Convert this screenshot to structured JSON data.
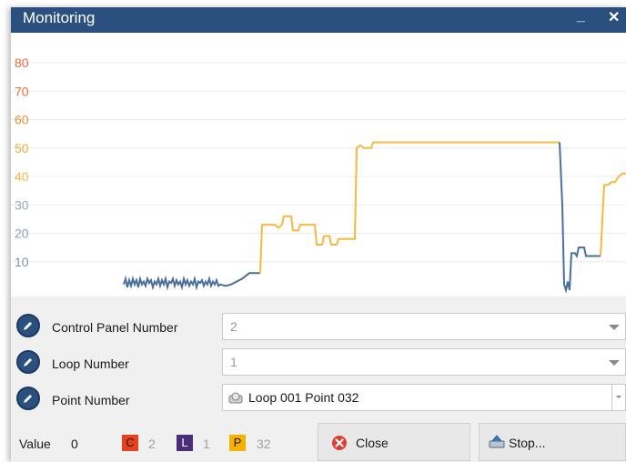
{
  "window": {
    "title": "Monitoring",
    "minimize_label": "_",
    "close_label": "✕"
  },
  "chart_data": {
    "type": "line",
    "y_ticks": [
      "80",
      "70",
      "60",
      "50",
      "40",
      "30",
      "20",
      "10"
    ],
    "ylim": [
      0,
      88
    ],
    "grid": true,
    "series": [
      {
        "color": "#4a6f9a",
        "points": [
          [
            124,
            2
          ],
          [
            126,
            4
          ],
          [
            128,
            1
          ],
          [
            130,
            3.5
          ],
          [
            132,
            1.5
          ],
          [
            134,
            4
          ],
          [
            136,
            2
          ],
          [
            138,
            3.5
          ],
          [
            140,
            1
          ],
          [
            142,
            4
          ],
          [
            144,
            2
          ],
          [
            146,
            3
          ],
          [
            148,
            1.5
          ],
          [
            150,
            4
          ],
          [
            152,
            2.5
          ],
          [
            154,
            3.5
          ],
          [
            156,
            1
          ],
          [
            158,
            3
          ],
          [
            160,
            2
          ],
          [
            162,
            4
          ],
          [
            164,
            1.5
          ],
          [
            166,
            3.5
          ],
          [
            168,
            2
          ],
          [
            170,
            4
          ],
          [
            172,
            1
          ],
          [
            174,
            3
          ],
          [
            176,
            2.5
          ],
          [
            178,
            4
          ],
          [
            180,
            1.5
          ],
          [
            182,
            3.5
          ],
          [
            184,
            2
          ],
          [
            186,
            3
          ],
          [
            188,
            1
          ],
          [
            190,
            4
          ],
          [
            192,
            2
          ],
          [
            194,
            3.5
          ],
          [
            196,
            1.5
          ],
          [
            198,
            3
          ],
          [
            200,
            2
          ],
          [
            202,
            4
          ],
          [
            204,
            1
          ],
          [
            206,
            3
          ],
          [
            208,
            2.5
          ],
          [
            210,
            3.5
          ],
          [
            212,
            1.5
          ],
          [
            214,
            3
          ],
          [
            216,
            2
          ],
          [
            218,
            4
          ],
          [
            220,
            1.5
          ],
          [
            222,
            3
          ],
          [
            224,
            2
          ],
          [
            226,
            3.5
          ],
          [
            228,
            1.5
          ],
          [
            230,
            2
          ],
          [
            236,
            1.5
          ],
          [
            242,
            2
          ],
          [
            248,
            3
          ],
          [
            254,
            4
          ],
          [
            258,
            5
          ],
          [
            262,
            6
          ],
          [
            268,
            6
          ],
          [
            274,
            6
          ]
        ]
      },
      {
        "color": "#f5b942",
        "points": [
          [
            274,
            6
          ],
          [
            276,
            23
          ],
          [
            290,
            23
          ],
          [
            294,
            22
          ],
          [
            298,
            23
          ],
          [
            300,
            26
          ],
          [
            308,
            26
          ],
          [
            310,
            21
          ],
          [
            316,
            21
          ],
          [
            318,
            23
          ],
          [
            334,
            23
          ],
          [
            336,
            16
          ],
          [
            342,
            16
          ],
          [
            344,
            19
          ],
          [
            350,
            19
          ],
          [
            352,
            16
          ],
          [
            358,
            16
          ],
          [
            360,
            18
          ],
          [
            378,
            18
          ],
          [
            380,
            50
          ],
          [
            384,
            51
          ],
          [
            388,
            50
          ],
          [
            396,
            50
          ],
          [
            398,
            52
          ],
          [
            420,
            52
          ],
          [
            440,
            52
          ],
          [
            480,
            52
          ],
          [
            520,
            52
          ],
          [
            560,
            52
          ],
          [
            590,
            52
          ],
          [
            603,
            52
          ]
        ]
      },
      {
        "color": "#4a6f9a",
        "points": [
          [
            603,
            52
          ],
          [
            606,
            30
          ],
          [
            608,
            2
          ],
          [
            610,
            0
          ],
          [
            612,
            3
          ],
          [
            614,
            0
          ],
          [
            616,
            13
          ],
          [
            620,
            13
          ],
          [
            622,
            12
          ],
          [
            624,
            15
          ],
          [
            630,
            15
          ],
          [
            632,
            12
          ],
          [
            644,
            12
          ],
          [
            648,
            12
          ]
        ]
      },
      {
        "color": "#f5b942",
        "points": [
          [
            648,
            12
          ],
          [
            652,
            37
          ],
          [
            656,
            37
          ],
          [
            660,
            38
          ],
          [
            664,
            38
          ],
          [
            668,
            40
          ],
          [
            672,
            41
          ],
          [
            676,
            41
          ]
        ]
      }
    ]
  },
  "controls": {
    "control_panel": {
      "label": "Control Panel Number",
      "value": "2"
    },
    "loop": {
      "label": "Loop Number",
      "value": "1"
    },
    "point": {
      "label": "Point Number",
      "value": "Loop  001 Point 032"
    }
  },
  "status": {
    "value_label": "Value",
    "value": "0",
    "c_label": "C",
    "c_value": "2",
    "l_label": "L",
    "l_value": "1",
    "p_label": "P",
    "p_value": "32",
    "colors": {
      "C": "#e8401c",
      "L": "#4b2c7a",
      "P": "#f5b000"
    }
  },
  "buttons": {
    "close_label": "Close",
    "stop_label": "Stop..."
  }
}
